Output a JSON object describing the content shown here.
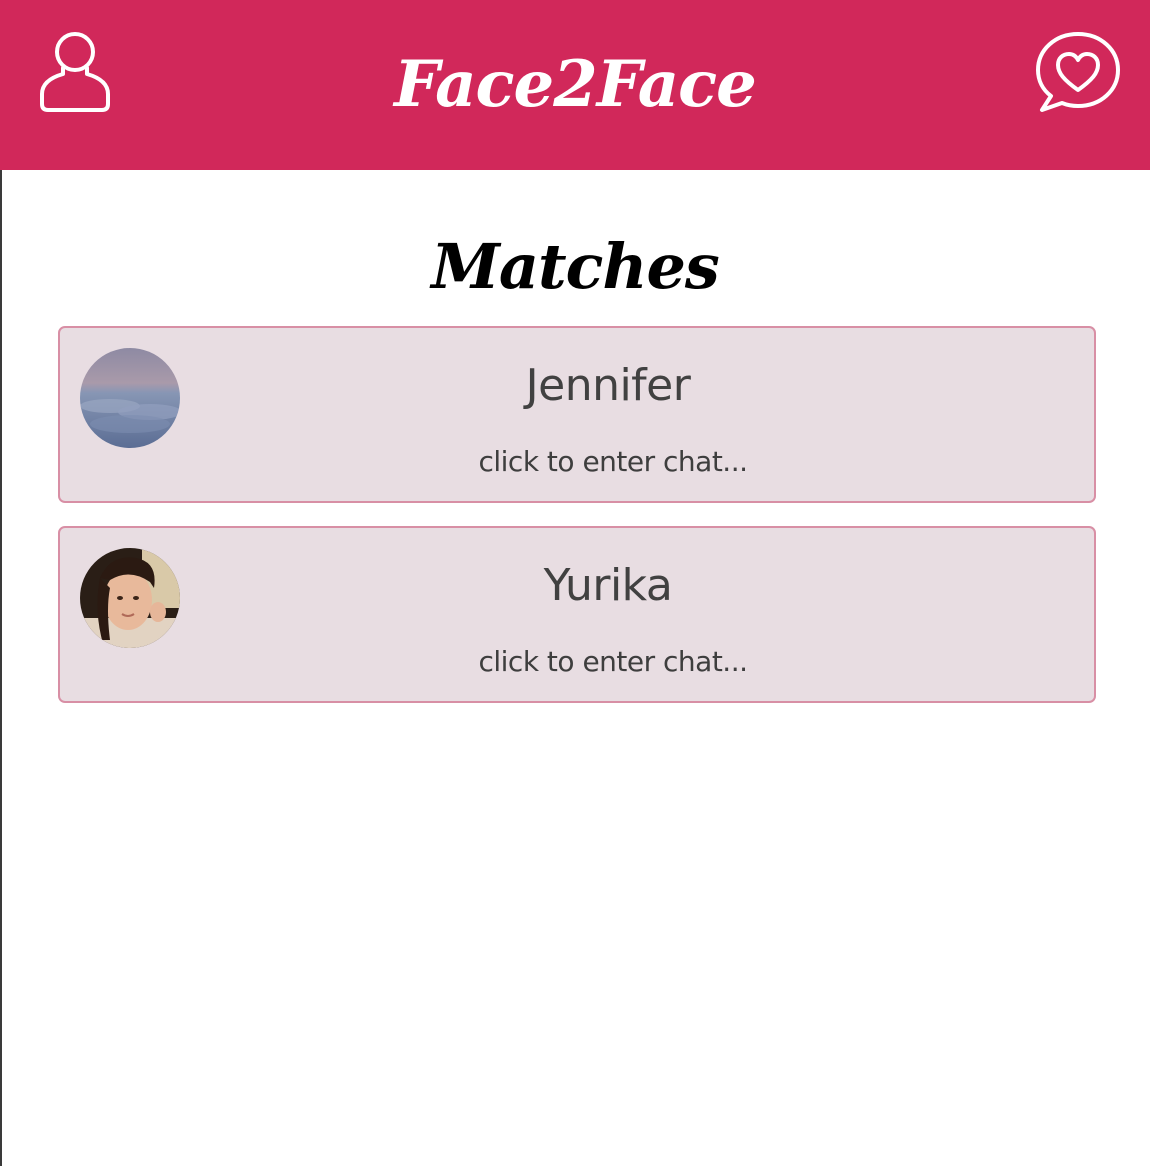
{
  "header": {
    "logo_text": "Face2Face",
    "profile_icon": "user-icon",
    "matches_icon": "heart-chat-icon",
    "background_color": "#d1285a"
  },
  "page": {
    "title": "Matches"
  },
  "matches": [
    {
      "name": "Jennifer",
      "subtitle": "click to enter chat...",
      "avatar": "landscape-photo"
    },
    {
      "name": "Yurika",
      "subtitle": "click to enter chat...",
      "avatar": "portrait-photo"
    }
  ],
  "colors": {
    "card_background": "#e8dde2",
    "card_border": "#d88fa5",
    "text_dark": "#414141"
  }
}
